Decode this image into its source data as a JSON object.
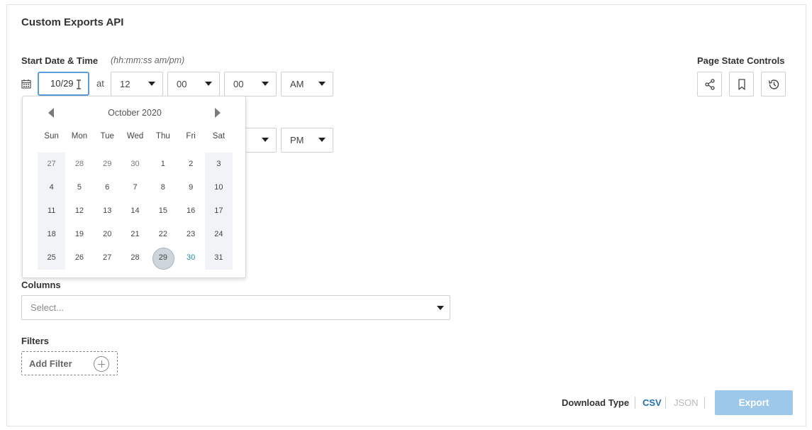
{
  "title": "Custom Exports API",
  "start": {
    "label": "Start Date & Time",
    "hint": "(hh:mm:ss am/pm)",
    "date_value": "10/29",
    "at": "at",
    "hour": "12",
    "minute": "00",
    "second": "00",
    "ampm": "AM"
  },
  "end": {
    "ampm": "PM"
  },
  "calendar": {
    "month": "October 2020",
    "weekdays": [
      "Sun",
      "Mon",
      "Tue",
      "Wed",
      "Thu",
      "Fri",
      "Sat"
    ],
    "weeks": [
      [
        "27",
        "28",
        "29",
        "30",
        "1",
        "2",
        "3"
      ],
      [
        "4",
        "5",
        "6",
        "7",
        "8",
        "9",
        "10"
      ],
      [
        "11",
        "12",
        "13",
        "14",
        "15",
        "16",
        "17"
      ],
      [
        "18",
        "19",
        "20",
        "21",
        "22",
        "23",
        "24"
      ],
      [
        "25",
        "26",
        "27",
        "28",
        "29",
        "30",
        "31"
      ]
    ],
    "selected_day": "29",
    "today_day": "30"
  },
  "page_state": {
    "label": "Page State Controls",
    "buttons": [
      "share-icon",
      "bookmark-icon",
      "history-icon"
    ]
  },
  "columns": {
    "label": "Columns",
    "placeholder": "Select..."
  },
  "filters": {
    "label": "Filters",
    "add_label": "Add Filter"
  },
  "download": {
    "label": "Download Type",
    "csv": "CSV",
    "json": "JSON",
    "export_label": "Export"
  },
  "colors": {
    "accent": "#1f6fb5",
    "focus_border": "#5b9dd9",
    "export_disabled": "#9ec8ea",
    "today": "#1a8c9c"
  }
}
